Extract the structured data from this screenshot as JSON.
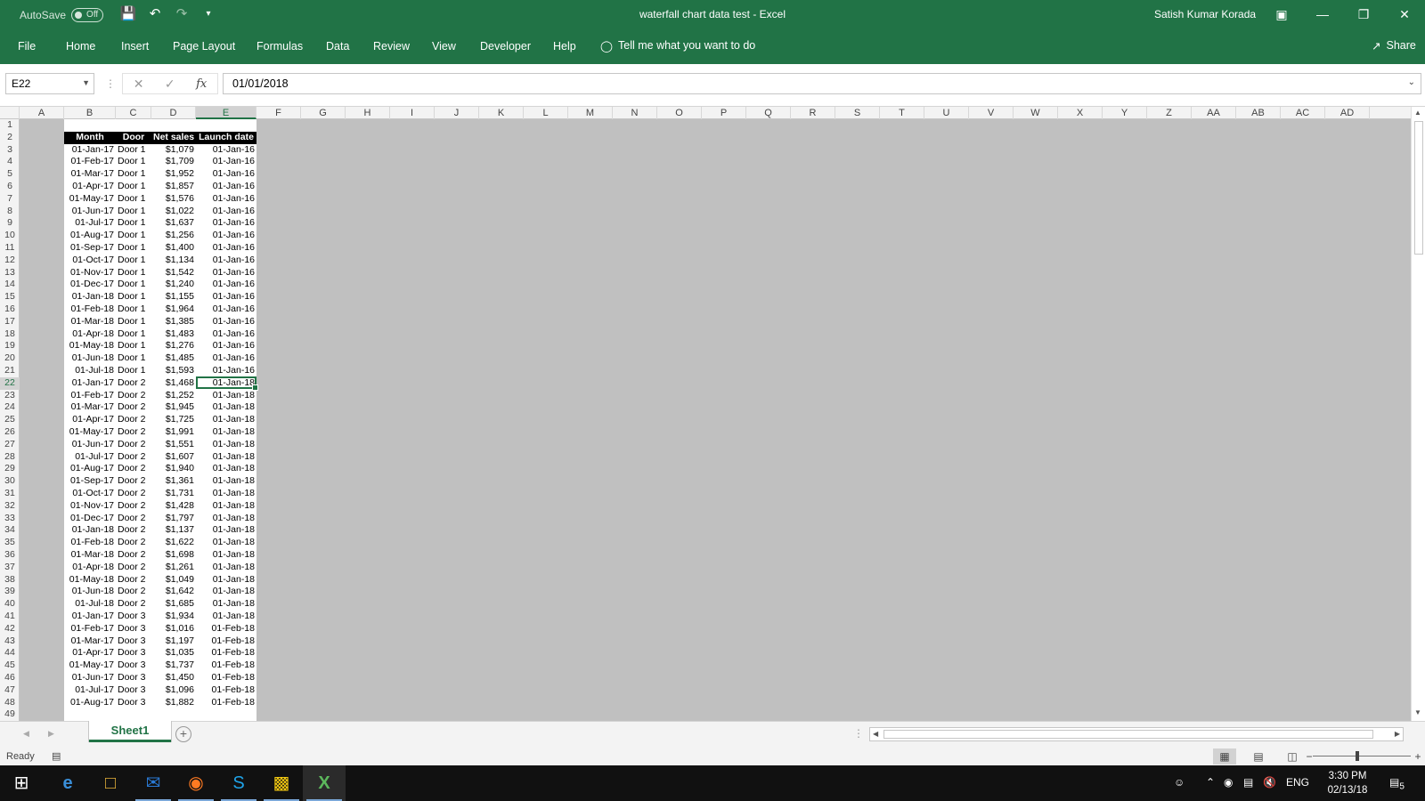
{
  "titlebar": {
    "autosave_label": "AutoSave",
    "autosave_state": "Off",
    "title": "waterfall chart data test  -  Excel",
    "user": "Satish Kumar Korada"
  },
  "ribbon": {
    "tabs": [
      "File",
      "Home",
      "Insert",
      "Page Layout",
      "Formulas",
      "Data",
      "Review",
      "View",
      "Developer",
      "Help"
    ],
    "tell_me": "Tell me what you want to do",
    "share": "Share"
  },
  "formula_bar": {
    "name_box": "E22",
    "formula": "01/01/2018"
  },
  "columns": [
    "A",
    "B",
    "C",
    "D",
    "E",
    "F",
    "G",
    "H",
    "I",
    "J",
    "K",
    "L",
    "M",
    "N",
    "O",
    "P",
    "Q",
    "R",
    "S",
    "T",
    "U",
    "V",
    "W",
    "X",
    "Y",
    "Z",
    "AA",
    "AB",
    "AC",
    "AD"
  ],
  "selected_column": "E",
  "selected_row": 22,
  "table": {
    "headers": [
      "Month",
      "Door",
      "Net sales",
      "Launch date"
    ],
    "rows": [
      [
        "01-Jan-17",
        "Door 1",
        "$1,079",
        "01-Jan-16"
      ],
      [
        "01-Feb-17",
        "Door 1",
        "$1,709",
        "01-Jan-16"
      ],
      [
        "01-Mar-17",
        "Door 1",
        "$1,952",
        "01-Jan-16"
      ],
      [
        "01-Apr-17",
        "Door 1",
        "$1,857",
        "01-Jan-16"
      ],
      [
        "01-May-17",
        "Door 1",
        "$1,576",
        "01-Jan-16"
      ],
      [
        "01-Jun-17",
        "Door 1",
        "$1,022",
        "01-Jan-16"
      ],
      [
        "01-Jul-17",
        "Door 1",
        "$1,637",
        "01-Jan-16"
      ],
      [
        "01-Aug-17",
        "Door 1",
        "$1,256",
        "01-Jan-16"
      ],
      [
        "01-Sep-17",
        "Door 1",
        "$1,400",
        "01-Jan-16"
      ],
      [
        "01-Oct-17",
        "Door 1",
        "$1,134",
        "01-Jan-16"
      ],
      [
        "01-Nov-17",
        "Door 1",
        "$1,542",
        "01-Jan-16"
      ],
      [
        "01-Dec-17",
        "Door 1",
        "$1,240",
        "01-Jan-16"
      ],
      [
        "01-Jan-18",
        "Door 1",
        "$1,155",
        "01-Jan-16"
      ],
      [
        "01-Feb-18",
        "Door 1",
        "$1,964",
        "01-Jan-16"
      ],
      [
        "01-Mar-18",
        "Door 1",
        "$1,385",
        "01-Jan-16"
      ],
      [
        "01-Apr-18",
        "Door 1",
        "$1,483",
        "01-Jan-16"
      ],
      [
        "01-May-18",
        "Door 1",
        "$1,276",
        "01-Jan-16"
      ],
      [
        "01-Jun-18",
        "Door 1",
        "$1,485",
        "01-Jan-16"
      ],
      [
        "01-Jul-18",
        "Door 1",
        "$1,593",
        "01-Jan-16"
      ],
      [
        "01-Jan-17",
        "Door 2",
        "$1,468",
        "01-Jan-18"
      ],
      [
        "01-Feb-17",
        "Door 2",
        "$1,252",
        "01-Jan-18"
      ],
      [
        "01-Mar-17",
        "Door 2",
        "$1,945",
        "01-Jan-18"
      ],
      [
        "01-Apr-17",
        "Door 2",
        "$1,725",
        "01-Jan-18"
      ],
      [
        "01-May-17",
        "Door 2",
        "$1,991",
        "01-Jan-18"
      ],
      [
        "01-Jun-17",
        "Door 2",
        "$1,551",
        "01-Jan-18"
      ],
      [
        "01-Jul-17",
        "Door 2",
        "$1,607",
        "01-Jan-18"
      ],
      [
        "01-Aug-17",
        "Door 2",
        "$1,940",
        "01-Jan-18"
      ],
      [
        "01-Sep-17",
        "Door 2",
        "$1,361",
        "01-Jan-18"
      ],
      [
        "01-Oct-17",
        "Door 2",
        "$1,731",
        "01-Jan-18"
      ],
      [
        "01-Nov-17",
        "Door 2",
        "$1,428",
        "01-Jan-18"
      ],
      [
        "01-Dec-17",
        "Door 2",
        "$1,797",
        "01-Jan-18"
      ],
      [
        "01-Jan-18",
        "Door 2",
        "$1,137",
        "01-Jan-18"
      ],
      [
        "01-Feb-18",
        "Door 2",
        "$1,622",
        "01-Jan-18"
      ],
      [
        "01-Mar-18",
        "Door 2",
        "$1,698",
        "01-Jan-18"
      ],
      [
        "01-Apr-18",
        "Door 2",
        "$1,261",
        "01-Jan-18"
      ],
      [
        "01-May-18",
        "Door 2",
        "$1,049",
        "01-Jan-18"
      ],
      [
        "01-Jun-18",
        "Door 2",
        "$1,642",
        "01-Jan-18"
      ],
      [
        "01-Jul-18",
        "Door 2",
        "$1,685",
        "01-Jan-18"
      ],
      [
        "01-Jan-17",
        "Door 3",
        "$1,934",
        "01-Jan-18"
      ],
      [
        "01-Feb-17",
        "Door 3",
        "$1,016",
        "01-Feb-18"
      ],
      [
        "01-Mar-17",
        "Door 3",
        "$1,197",
        "01-Feb-18"
      ],
      [
        "01-Apr-17",
        "Door 3",
        "$1,035",
        "01-Feb-18"
      ],
      [
        "01-May-17",
        "Door 3",
        "$1,737",
        "01-Feb-18"
      ],
      [
        "01-Jun-17",
        "Door 3",
        "$1,450",
        "01-Feb-18"
      ],
      [
        "01-Jul-17",
        "Door 3",
        "$1,096",
        "01-Feb-18"
      ],
      [
        "01-Aug-17",
        "Door 3",
        "$1,882",
        "01-Feb-18"
      ]
    ]
  },
  "sheets": [
    "Sheet1"
  ],
  "status": {
    "ready": "Ready"
  },
  "taskbar": {
    "language": "ENG",
    "time": "3:30 PM",
    "date": "02/13/18",
    "notification_count": "5"
  },
  "colors": {
    "excel_green": "#217346",
    "grid_background": "#c0c0c0"
  }
}
